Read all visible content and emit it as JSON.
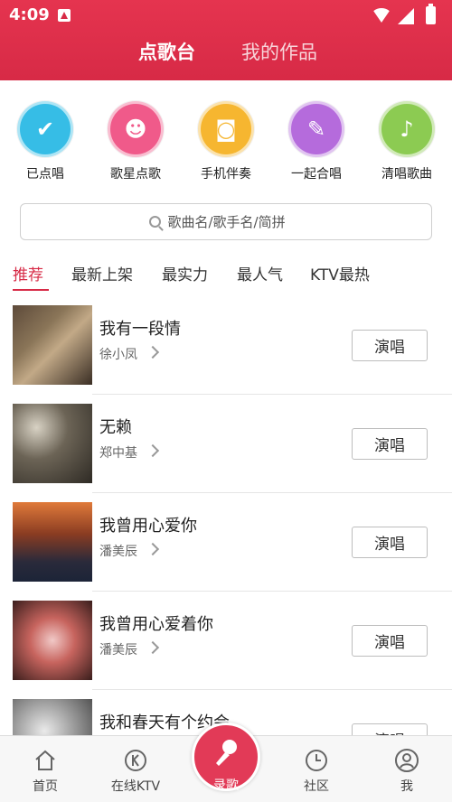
{
  "status": {
    "time": "4:09"
  },
  "header": {
    "tabs": [
      "点歌台",
      "我的作品"
    ]
  },
  "features": [
    {
      "label": "已点唱",
      "color": "#36bde6",
      "icon": "check-icon"
    },
    {
      "label": "歌星点歌",
      "color": "#f05a8a",
      "icon": "singer-icon"
    },
    {
      "label": "手机伴奏",
      "color": "#f6b630",
      "icon": "speaker-icon"
    },
    {
      "label": "一起合唱",
      "color": "#b56bdc",
      "icon": "mic-icon"
    },
    {
      "label": "清唱歌曲",
      "color": "#8ccb52",
      "icon": "music-note-icon"
    }
  ],
  "search": {
    "placeholder": "歌曲名/歌手名/简拼"
  },
  "categories": [
    "推荐",
    "最新上架",
    "最实力",
    "最人气",
    "KTV最热"
  ],
  "songs": [
    {
      "title": "我有一段情",
      "artist": "徐小凤",
      "action": "演唱"
    },
    {
      "title": "无赖",
      "artist": "郑中基",
      "action": "演唱"
    },
    {
      "title": "我曾用心爱你",
      "artist": "潘美辰",
      "action": "演唱"
    },
    {
      "title": "我曾用心爱着你",
      "artist": "潘美辰",
      "action": "演唱"
    },
    {
      "title": "我和春天有个约会",
      "artist": "",
      "action": "演唱"
    }
  ],
  "bottom_nav": [
    "首页",
    "在线KTV",
    "录歌",
    "社区",
    "我"
  ],
  "colors": {
    "primary": "#d72a46"
  }
}
